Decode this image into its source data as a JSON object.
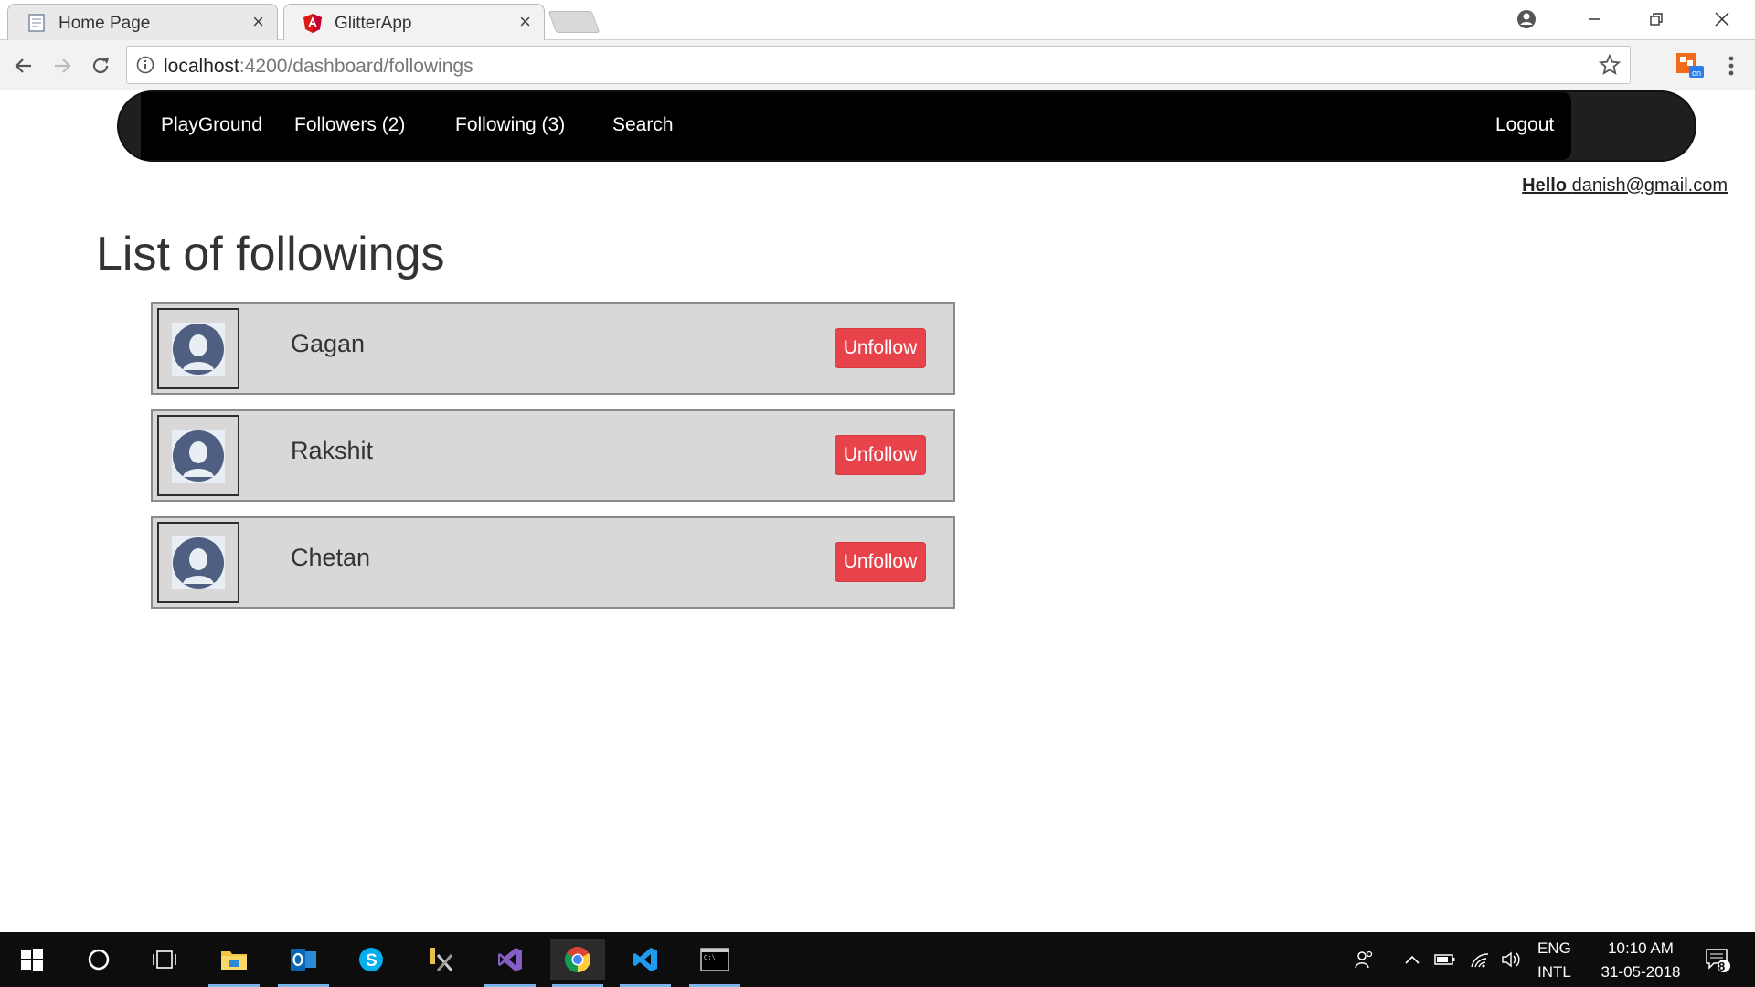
{
  "browser": {
    "tabs": [
      {
        "title": "Home Page",
        "close": "×"
      },
      {
        "title": "GlitterApp",
        "close": "×"
      }
    ],
    "url_host": "localhost",
    "url_path": ":4200/dashboard/followings"
  },
  "navbar": {
    "links": [
      "PlayGround",
      "Followers (2)",
      "Following (3)",
      "Search"
    ],
    "logout": "Logout"
  },
  "greeting": {
    "label": "Hello",
    "email": "danish@gmail.com"
  },
  "page": {
    "title": "List of followings"
  },
  "followings": [
    {
      "name": "Gagan",
      "action": "Unfollow"
    },
    {
      "name": "Rakshit",
      "action": "Unfollow"
    },
    {
      "name": "Chetan",
      "action": "Unfollow"
    }
  ],
  "taskbar": {
    "lang_top": "ENG",
    "lang_bottom": "INTL",
    "time": "10:10 AM",
    "date": "31-05-2018",
    "notifications": "8"
  },
  "colors": {
    "navbar_bg": "#000000",
    "card_bg": "#d9d7d8",
    "unfollow_button": "#e8424a",
    "avatar": "#4f5f82"
  }
}
